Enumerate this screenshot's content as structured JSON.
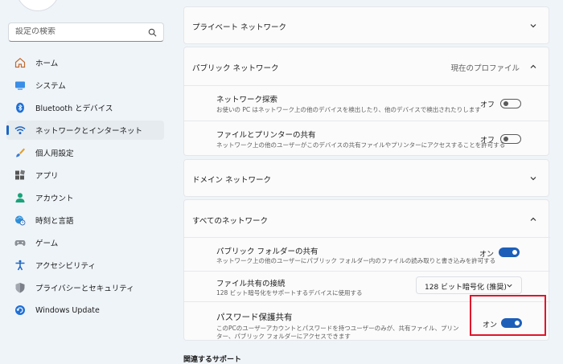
{
  "search": {
    "placeholder": "設定の検索"
  },
  "sidebar": {
    "items": [
      {
        "label": "ホーム",
        "icon": "home-icon"
      },
      {
        "label": "システム",
        "icon": "system-icon"
      },
      {
        "label": "Bluetooth とデバイス",
        "icon": "bluetooth-icon"
      },
      {
        "label": "ネットワークとインターネット",
        "icon": "wifi-icon",
        "selected": true
      },
      {
        "label": "個人用設定",
        "icon": "brush-icon"
      },
      {
        "label": "アプリ",
        "icon": "apps-icon"
      },
      {
        "label": "アカウント",
        "icon": "account-icon"
      },
      {
        "label": "時刻と言語",
        "icon": "globe-clock-icon"
      },
      {
        "label": "ゲーム",
        "icon": "gamepad-icon"
      },
      {
        "label": "アクセシビリティ",
        "icon": "accessibility-icon"
      },
      {
        "label": "プライバシーとセキュリティ",
        "icon": "shield-icon"
      },
      {
        "label": "Windows Update",
        "icon": "update-icon"
      }
    ]
  },
  "main": {
    "private_network": {
      "title": "プライベート ネットワーク"
    },
    "public_network": {
      "title": "パブリック ネットワーク",
      "current_profile": "現在のプロファイル",
      "rows": [
        {
          "title": "ネットワーク探索",
          "desc": "お使いの PC はネットワーク上の他のデバイスを検出したり、他のデバイスで検出されたりします",
          "state": "オフ"
        },
        {
          "title": "ファイルとプリンターの共有",
          "desc": "ネットワーク上の他のユーザーがこのデバイスの共有ファイルやプリンターにアクセスすることを許可する",
          "state": "オフ"
        }
      ]
    },
    "domain_network": {
      "title": "ドメイン ネットワーク"
    },
    "all_networks": {
      "title": "すべてのネットワーク",
      "public_folder": {
        "title": "パブリック フォルダーの共有",
        "desc": "ネットワーク上の他のユーザーにパブリック フォルダー内のファイルの読み取りと書き込みを許可する",
        "state": "オン"
      },
      "file_sharing": {
        "title": "ファイル共有の接続",
        "desc": "128 ビット暗号化をサポートするデバイスに使用する",
        "value": "128 ビット暗号化 (推奨)"
      },
      "password_sharing": {
        "title": "パスワード保護共有",
        "desc1": "このPCのユーザーアカウントとパスワードを持つユーザーのみが、共有ファイル、プリン",
        "desc2": "ター、パブリック フォルダーにアクセスできます",
        "state": "オン"
      }
    },
    "related_support": "関連するサポート"
  },
  "colors": {
    "accent": "#1d5fb8",
    "highlight": "#e0152b",
    "background": "#eff4f9"
  }
}
